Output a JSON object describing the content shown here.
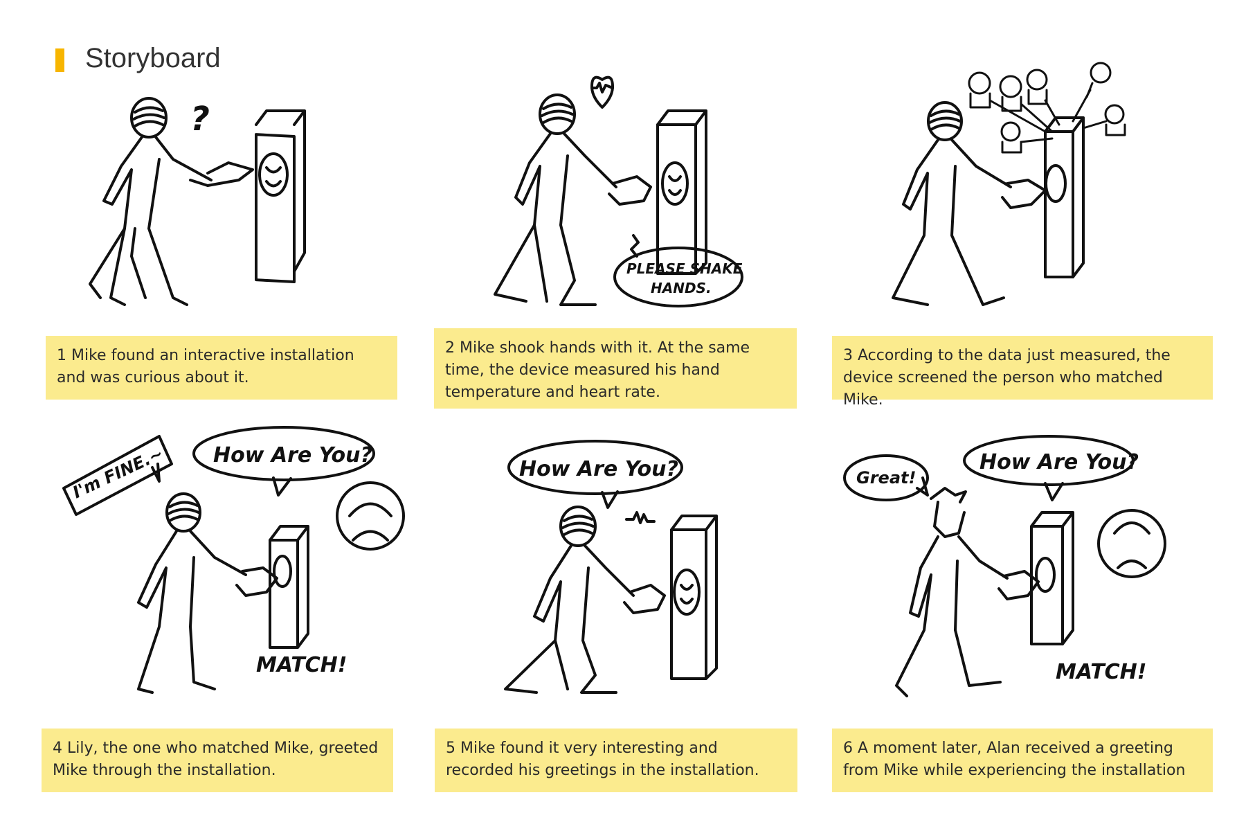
{
  "header": {
    "title": "Storyboard",
    "accent_color": "#f7b500"
  },
  "caption_color": "#fbeb8e",
  "panels": [
    {
      "caption": "1 Mike found an interactive installation and was curious about it.",
      "drawing_text": [
        "?"
      ]
    },
    {
      "caption": "2 Mike shook hands with it. At the same time, the device measured his hand temperature and heart rate.",
      "drawing_text": [
        "PLEASE SHAKE",
        "HANDS."
      ]
    },
    {
      "caption": "3 According to the data just measured, the device screened the person who matched Mike.",
      "drawing_text": []
    },
    {
      "caption": "4 Lily, the one who matched Mike, greeted Mike through the installation.",
      "drawing_text": [
        "I'm FINE.~",
        "How Are You?",
        "MATCH!"
      ]
    },
    {
      "caption": "5 Mike found it very interesting and recorded his greetings in the installation.",
      "drawing_text": [
        "How Are You?"
      ]
    },
    {
      "caption": "6 A moment later, Alan received a greeting from Mike while experiencing the installation",
      "drawing_text": [
        "Great!",
        "How Are You?",
        "MATCH!"
      ]
    }
  ]
}
